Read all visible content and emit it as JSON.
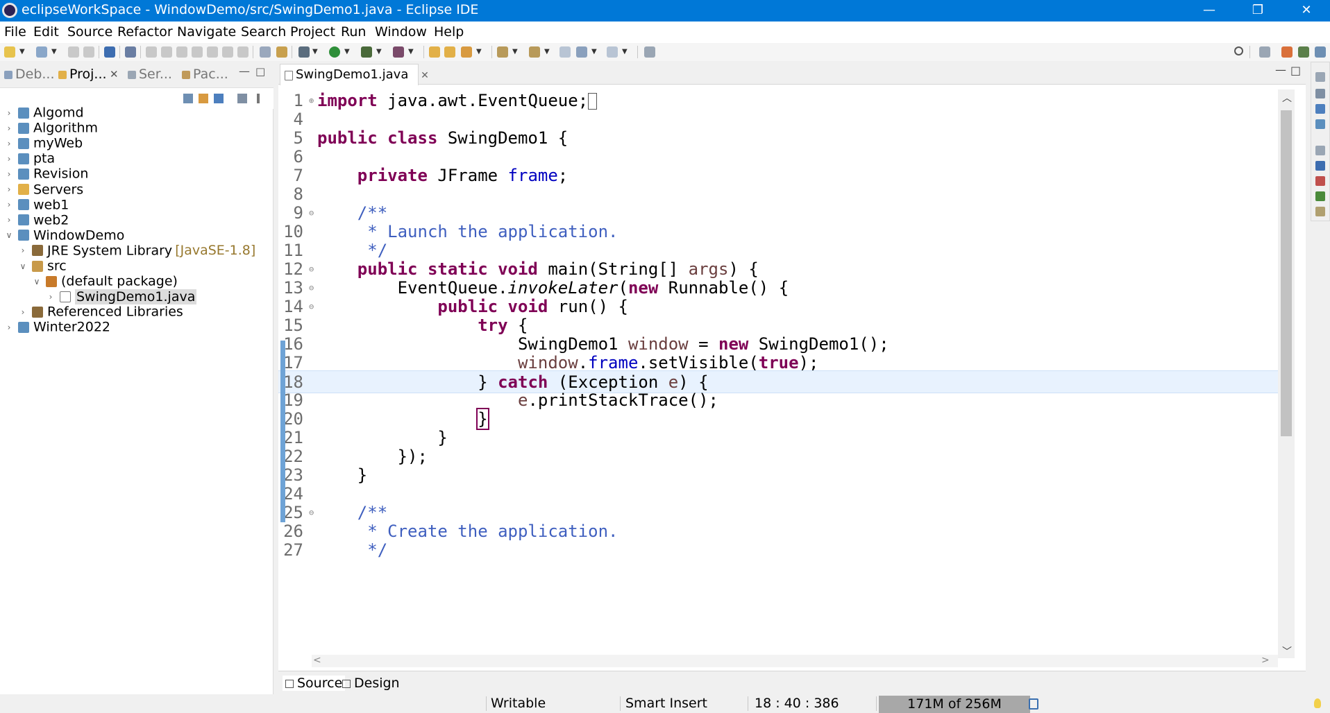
{
  "window": {
    "title": "eclipseWorkSpace - WindowDemo/src/SwingDemo1.java - Eclipse IDE",
    "minimize_glyph": "—",
    "restore_glyph": "❐",
    "close_glyph": "✕"
  },
  "menu": [
    "File",
    "Edit",
    "Source",
    "Refactor",
    "Navigate",
    "Search",
    "Project",
    "Run",
    "Window",
    "Help"
  ],
  "left_panel": {
    "tabs": [
      {
        "label": "Deb...",
        "active": false
      },
      {
        "label": "Proj...",
        "active": true
      },
      {
        "label": "Ser...",
        "active": false
      },
      {
        "label": "Pac...",
        "active": false
      }
    ],
    "tree": [
      {
        "label": "Algomd",
        "depth": 0,
        "expanded": false,
        "icon": "project-icon"
      },
      {
        "label": "Algorithm",
        "depth": 0,
        "expanded": false,
        "icon": "project-icon"
      },
      {
        "label": "myWeb",
        "depth": 0,
        "expanded": false,
        "icon": "project-icon"
      },
      {
        "label": "pta",
        "depth": 0,
        "expanded": false,
        "icon": "project-icon"
      },
      {
        "label": "Revision",
        "depth": 0,
        "expanded": false,
        "icon": "project-icon"
      },
      {
        "label": "Servers",
        "depth": 0,
        "expanded": false,
        "icon": "folder-icon"
      },
      {
        "label": "web1",
        "depth": 0,
        "expanded": false,
        "icon": "project-icon"
      },
      {
        "label": "web2",
        "depth": 0,
        "expanded": false,
        "icon": "project-icon"
      },
      {
        "label": "WindowDemo",
        "depth": 0,
        "expanded": true,
        "icon": "project-icon"
      },
      {
        "label": "JRE System Library",
        "decoration": "[JavaSE-1.8]",
        "depth": 1,
        "expanded": false,
        "icon": "library-icon"
      },
      {
        "label": "src",
        "depth": 1,
        "expanded": true,
        "icon": "source-folder-icon"
      },
      {
        "label": "(default package)",
        "depth": 2,
        "expanded": true,
        "icon": "package-icon"
      },
      {
        "label": "SwingDemo1.java",
        "depth": 3,
        "expanded": false,
        "icon": "java-file-icon",
        "selected": true
      },
      {
        "label": "Referenced Libraries",
        "depth": 1,
        "expanded": false,
        "icon": "library-icon"
      },
      {
        "label": "Winter2022",
        "depth": 0,
        "expanded": false,
        "icon": "project-icon"
      }
    ]
  },
  "editor": {
    "tab_label": "SwingDemo1.java",
    "tab_close": "✕",
    "current_line": 18,
    "lines": [
      {
        "num": "1",
        "fold": "⊕"
      },
      {
        "num": "4",
        "fold": ""
      },
      {
        "num": "5",
        "fold": ""
      },
      {
        "num": "6",
        "fold": ""
      },
      {
        "num": "7",
        "fold": ""
      },
      {
        "num": "8",
        "fold": ""
      },
      {
        "num": "9",
        "fold": "⊖"
      },
      {
        "num": "10",
        "fold": ""
      },
      {
        "num": "11",
        "fold": ""
      },
      {
        "num": "12",
        "fold": "⊖"
      },
      {
        "num": "13",
        "fold": "⊖"
      },
      {
        "num": "14",
        "fold": "⊖"
      },
      {
        "num": "15",
        "fold": ""
      },
      {
        "num": "16",
        "fold": ""
      },
      {
        "num": "17",
        "fold": ""
      },
      {
        "num": "18",
        "fold": ""
      },
      {
        "num": "19",
        "fold": ""
      },
      {
        "num": "20",
        "fold": ""
      },
      {
        "num": "21",
        "fold": ""
      },
      {
        "num": "22",
        "fold": ""
      },
      {
        "num": "23",
        "fold": ""
      },
      {
        "num": "24",
        "fold": ""
      },
      {
        "num": "25",
        "fold": "⊖"
      },
      {
        "num": "26",
        "fold": ""
      },
      {
        "num": "27",
        "fold": ""
      }
    ],
    "code": [
      [
        {
          "t": "import",
          "c": "kw"
        },
        {
          "t": " java.awt.EventQueue;"
        },
        {
          "t": "",
          "c": "cursorbox"
        }
      ],
      [],
      [
        {
          "t": "public class",
          "c": "kw"
        },
        {
          "t": " SwingDemo1 {"
        }
      ],
      [],
      [
        {
          "t": "    "
        },
        {
          "t": "private",
          "c": "kw"
        },
        {
          "t": " JFrame "
        },
        {
          "t": "frame",
          "c": "fd"
        },
        {
          "t": ";"
        }
      ],
      [],
      [
        {
          "t": "    /**",
          "c": "cm"
        }
      ],
      [
        {
          "t": "     * Launch the application.",
          "c": "cm"
        }
      ],
      [
        {
          "t": "     */",
          "c": "cm"
        }
      ],
      [
        {
          "t": "    "
        },
        {
          "t": "public static void",
          "c": "kw"
        },
        {
          "t": " main(String[] "
        },
        {
          "t": "args",
          "c": "lv"
        },
        {
          "t": ") {"
        }
      ],
      [
        {
          "t": "        EventQueue."
        },
        {
          "t": "invokeLater",
          "c": "it"
        },
        {
          "t": "("
        },
        {
          "t": "new",
          "c": "kw"
        },
        {
          "t": " Runnable() {"
        }
      ],
      [
        {
          "t": "            "
        },
        {
          "t": "public void",
          "c": "kw"
        },
        {
          "t": " run() {"
        }
      ],
      [
        {
          "t": "                "
        },
        {
          "t": "try",
          "c": "kw"
        },
        {
          "t": " {"
        }
      ],
      [
        {
          "t": "                    SwingDemo1 "
        },
        {
          "t": "window",
          "c": "lv"
        },
        {
          "t": " = "
        },
        {
          "t": "new",
          "c": "kw"
        },
        {
          "t": " SwingDemo1();"
        }
      ],
      [
        {
          "t": "                    "
        },
        {
          "t": "window",
          "c": "lv"
        },
        {
          "t": "."
        },
        {
          "t": "frame",
          "c": "fd"
        },
        {
          "t": ".setVisible("
        },
        {
          "t": "true",
          "c": "kw"
        },
        {
          "t": ");"
        }
      ],
      [
        {
          "t": "                } "
        },
        {
          "t": "catch",
          "c": "kw"
        },
        {
          "t": " (Exception "
        },
        {
          "t": "e",
          "c": "lv"
        },
        {
          "t": ") {"
        }
      ],
      [
        {
          "t": "                    "
        },
        {
          "t": "e",
          "c": "lv"
        },
        {
          "t": ".printStackTrace();"
        }
      ],
      [
        {
          "t": "                "
        },
        {
          "t": "}",
          "c": "box"
        }
      ],
      [
        {
          "t": "            }"
        }
      ],
      [
        {
          "t": "        });"
        }
      ],
      [
        {
          "t": "    }"
        }
      ],
      [],
      [
        {
          "t": "    /**",
          "c": "cm"
        }
      ],
      [
        {
          "t": "     * Create the application.",
          "c": "cm"
        }
      ],
      [
        {
          "t": "     */",
          "c": "cm"
        }
      ]
    ],
    "bottom_tabs": [
      {
        "label": "Source",
        "active": true
      },
      {
        "label": "Design",
        "active": false
      }
    ]
  },
  "status": {
    "writable": "Writable",
    "insert_mode": "Smart Insert",
    "position": "18 : 40 : 386",
    "heap": "171M of 256M"
  },
  "colors": {
    "titlebar": "#0078d7",
    "keyword": "#7f0055",
    "field": "#0000c0",
    "comment": "#3f5fbf",
    "local_var": "#6a3e3e",
    "current_line": "#e8f2fe"
  }
}
